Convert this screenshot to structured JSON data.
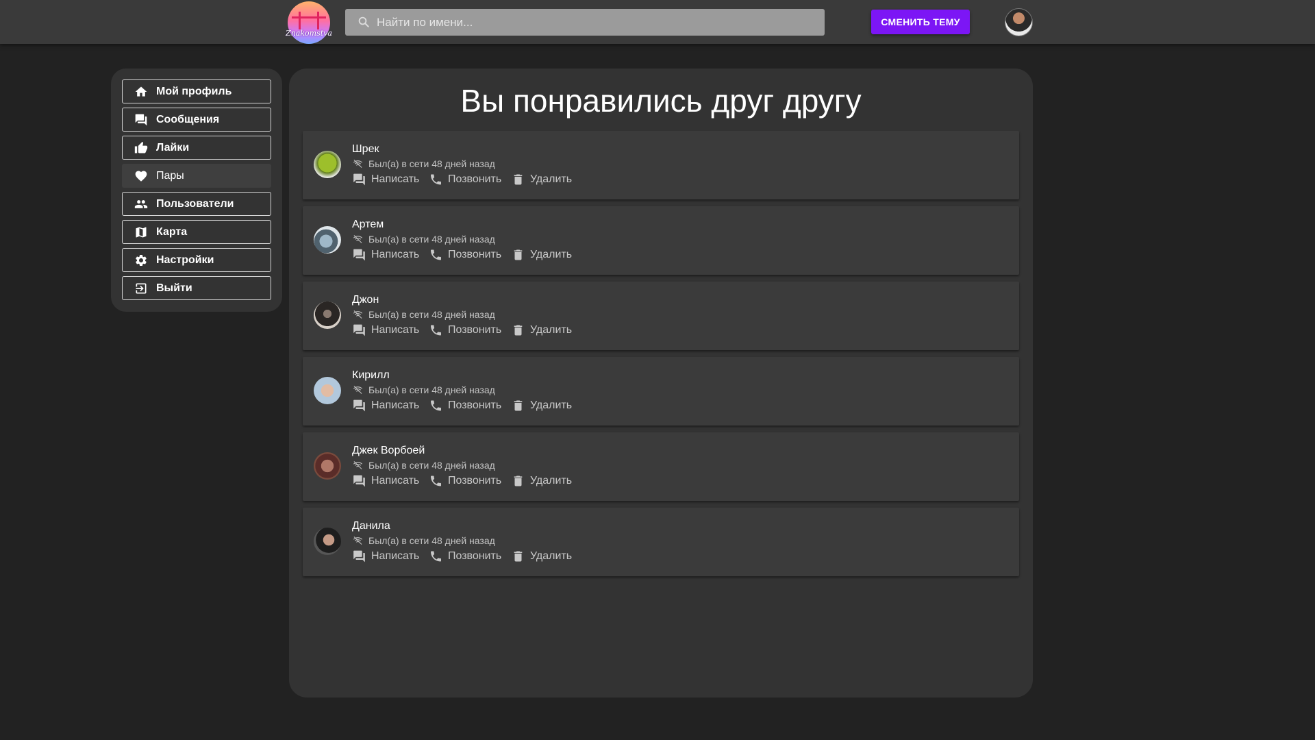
{
  "header": {
    "logo_text": "Znakomstva",
    "search_placeholder": "Найти по имени...",
    "theme_button": "СМЕНИТЬ ТЕМУ",
    "accent_color": "#7c16f5"
  },
  "sidebar": {
    "items": [
      {
        "label": "Мой профиль",
        "icon": "home-icon"
      },
      {
        "label": "Сообщения",
        "icon": "chat-icon"
      },
      {
        "label": "Лайки",
        "icon": "thumb-up-icon"
      },
      {
        "label": "Пары",
        "icon": "heart-icon",
        "active": true
      },
      {
        "label": "Пользователи",
        "icon": "people-icon"
      },
      {
        "label": "Карта",
        "icon": "map-icon"
      },
      {
        "label": "Настройки",
        "icon": "gear-icon"
      },
      {
        "label": "Выйти",
        "icon": "logout-icon"
      }
    ]
  },
  "main": {
    "title": "Вы понравились друг другу",
    "actions": {
      "write": "Написать",
      "call": "Позвонить",
      "delete": "Удалить"
    },
    "matches": [
      {
        "name": "Шрек",
        "status": "Был(а) в сети 48 дней назад"
      },
      {
        "name": "Артем",
        "status": "Был(а) в сети 48 дней назад"
      },
      {
        "name": "Джон",
        "status": "Был(а) в сети 48 дней назад"
      },
      {
        "name": "Кирилл",
        "status": "Был(а) в сети 48 дней назад"
      },
      {
        "name": "Джек Ворбоей",
        "status": "Был(а) в сети 48 дней назад"
      },
      {
        "name": "Данила",
        "status": "Был(а) в сети 48 дней назад"
      }
    ]
  }
}
